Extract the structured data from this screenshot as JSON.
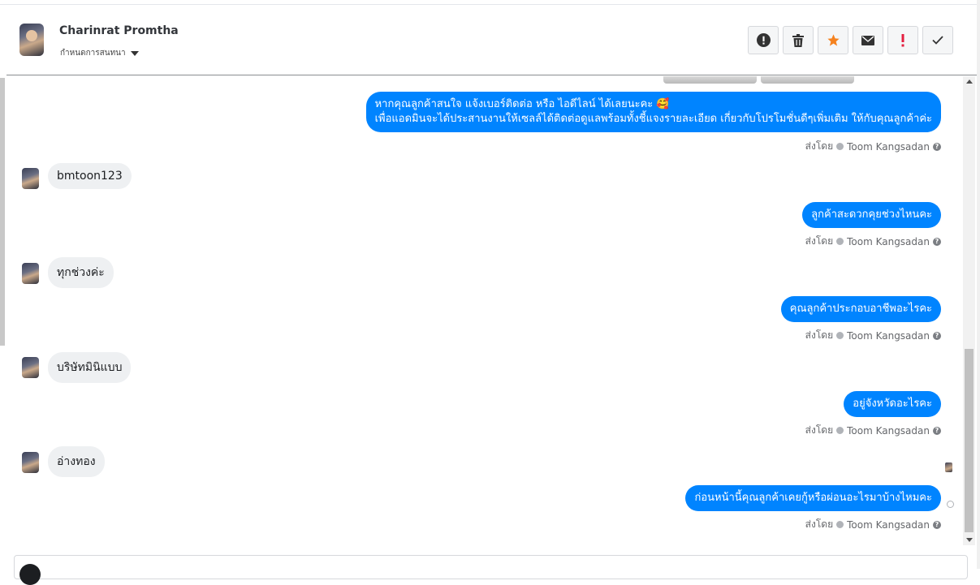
{
  "header": {
    "name": "Charinrat Promtha",
    "subtitle": "กำหนดการสนทนา"
  },
  "toolbar": {
    "buttons": [
      {
        "name": "alert-icon"
      },
      {
        "name": "trash-icon"
      },
      {
        "name": "star-icon",
        "color": "#f5821f"
      },
      {
        "name": "mail-icon"
      },
      {
        "name": "important-icon",
        "color": "#e41e3f"
      },
      {
        "name": "check-icon"
      }
    ]
  },
  "messages": {
    "m1": {
      "line1": "หากคุณลูกค้าสนใจ แจ้งเบอร์ติดต่อ หรือ ไอดีไลน์ ได้เลยนะคะ 🥰",
      "line2": "เพื่อแอดมินจะได้ประสานงานให้เซลล์ได้ติดต่อดูแลพร้อมทั้งชี้แจงรายละเอียด เกี่ยวกับโปรโมชั่นดีๆเพิ่มเติม ให้กับคุณลูกค้าค่ะ"
    },
    "m2": "bmtoon123",
    "m3": "ลูกค้าสะดวกคุยช่วงไหนคะ",
    "m4": "ทุกช่วงค่ะ",
    "m5": "คุณลูกค้าประกอบอาชีพอะไรคะ",
    "m6": "บริษัทมินิแบบ",
    "m7": "อยู่จังหวัดอะไรคะ",
    "m8": "อ่างทอง",
    "m9": "ก่อนหน้านี้คุณลูกค้าเคยกู้หรือผ่อนอะไรมาบ้างไหมคะ"
  },
  "sent_by": {
    "label": "ส่งโดย",
    "agent": "Toom Kangsadan"
  },
  "colors": {
    "outgoing_bubble": "#0084ff",
    "incoming_bubble": "#eef0f2"
  }
}
